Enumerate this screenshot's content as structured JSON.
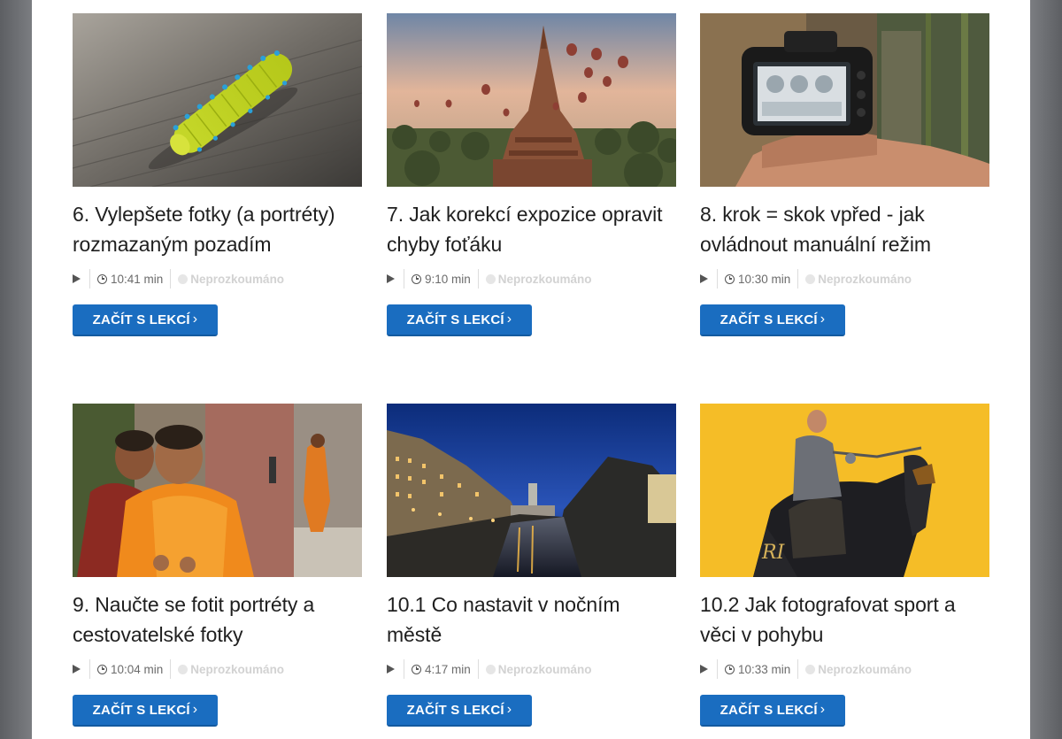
{
  "lessons": [
    {
      "title": "6. Vylepšete fotky (a portréty) rozmazaným pozadím",
      "duration": "10:41 min",
      "status": "Neprozkoumáno",
      "button_label": "ZAČÍT S LEKCÍ",
      "image_subject": "caterpillar"
    },
    {
      "title": "7. Jak korekcí expozice opravit chyby foťáku",
      "duration": "9:10 min",
      "status": "Neprozkoumáno",
      "button_label": "ZAČÍT S LEKCÍ",
      "image_subject": "pagoda-balloons"
    },
    {
      "title": "8. krok = skok vpřed - jak ovládnout manuální režim",
      "duration": "10:30 min",
      "status": "Neprozkoumáno",
      "button_label": "ZAČÍT S LEKCÍ",
      "image_subject": "camera-in-hand"
    },
    {
      "title": "9. Naučte se fotit portréty a cestovatelské fotky",
      "duration": "10:04 min",
      "status": "Neprozkoumáno",
      "button_label": "ZAČÍT S LEKCÍ",
      "image_subject": "young-monks"
    },
    {
      "title": "10.1 Co nastavit v nočním městě",
      "duration": "4:17 min",
      "status": "Neprozkoumáno",
      "button_label": "ZAČÍT S LEKCÍ",
      "image_subject": "night-city-river"
    },
    {
      "title": "10.2 Jak fotografovat sport a věci v pohybu",
      "duration": "10:33 min",
      "status": "Neprozkoumáno",
      "button_label": "ZAČÍT S LEKCÍ",
      "image_subject": "knight-on-horse"
    }
  ],
  "colors": {
    "button": "#1a6dc0",
    "title": "#1f1f1f",
    "status": "#d2d2d2"
  },
  "icons": {
    "play": "play-icon",
    "clock": "clock-icon",
    "status": "status-dot-icon",
    "chevron": "chevron-right-icon"
  }
}
